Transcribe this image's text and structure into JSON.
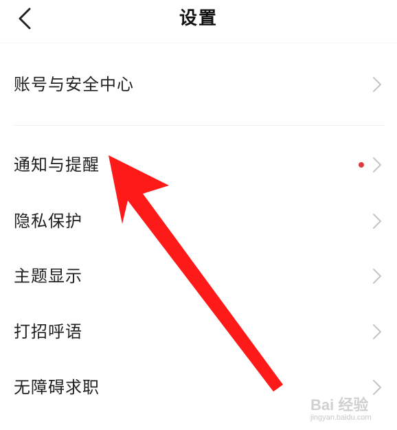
{
  "nav": {
    "title": "设置",
    "back_icon": "chevron-left-icon"
  },
  "settings": {
    "items": [
      {
        "label": "账号与安全中心",
        "has_badge": false
      },
      {
        "label": "通知与提醒",
        "has_badge": true
      },
      {
        "label": "隐私保护",
        "has_badge": false
      },
      {
        "label": "主题显示",
        "has_badge": false
      },
      {
        "label": "打招呼语",
        "has_badge": false
      },
      {
        "label": "无障碍求职",
        "has_badge": false
      }
    ],
    "chevron_icon": "chevron-right-icon"
  },
  "colors": {
    "badge": "#e03a3e",
    "chevron": "#c4c4c4",
    "annotation_arrow": "#ff1a1a"
  },
  "watermark": {
    "brand": "Bai 经验",
    "url": "jingyan.baidu.com"
  }
}
